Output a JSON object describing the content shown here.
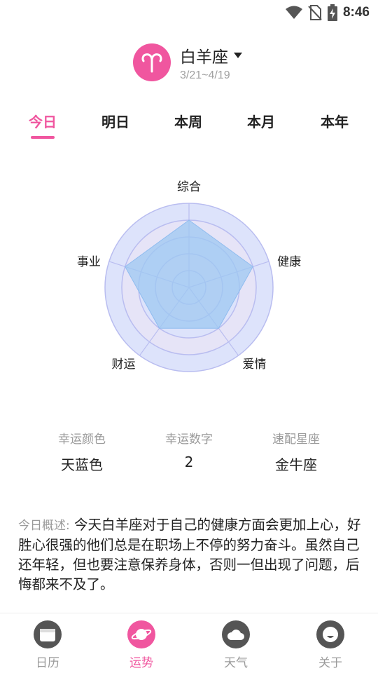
{
  "status": {
    "time": "8:46"
  },
  "sign": {
    "name": "白羊座",
    "dates": "3/21~4/19",
    "icon": "aries-icon",
    "accent": "#f0569f"
  },
  "tabs": [
    {
      "label": "今日",
      "active": true
    },
    {
      "label": "明日"
    },
    {
      "label": "本周"
    },
    {
      "label": "本月"
    },
    {
      "label": "本年"
    }
  ],
  "chart_data": {
    "type": "radar",
    "axes": [
      "综合",
      "健康",
      "爱情",
      "财运",
      "事业"
    ],
    "values": [
      80,
      80,
      60,
      60,
      80
    ],
    "max": 100,
    "rings": 5,
    "fill_color": "#9ec8f2",
    "background_color": "#dde3fb"
  },
  "lucky": {
    "color": {
      "title": "幸运颜色",
      "value": "天蓝色"
    },
    "number": {
      "title": "幸运数字",
      "value": "2"
    },
    "match": {
      "title": "速配星座",
      "value": "金牛座"
    }
  },
  "summary": {
    "label": "今日概述:",
    "text": "今天白羊座对于自己的健康方面会更加上心，好胜心很强的他们总是在职场上不停的努力奋斗。虽然自己还年轻，但也要注意保养身体，否则一但出现了问题，后悔都来不及了。"
  },
  "nav": [
    {
      "label": "日历",
      "icon": "calendar-icon"
    },
    {
      "label": "运势",
      "icon": "planet-icon",
      "active": true
    },
    {
      "label": "天气",
      "icon": "cloud-icon"
    },
    {
      "label": "关于",
      "icon": "face-icon"
    }
  ]
}
